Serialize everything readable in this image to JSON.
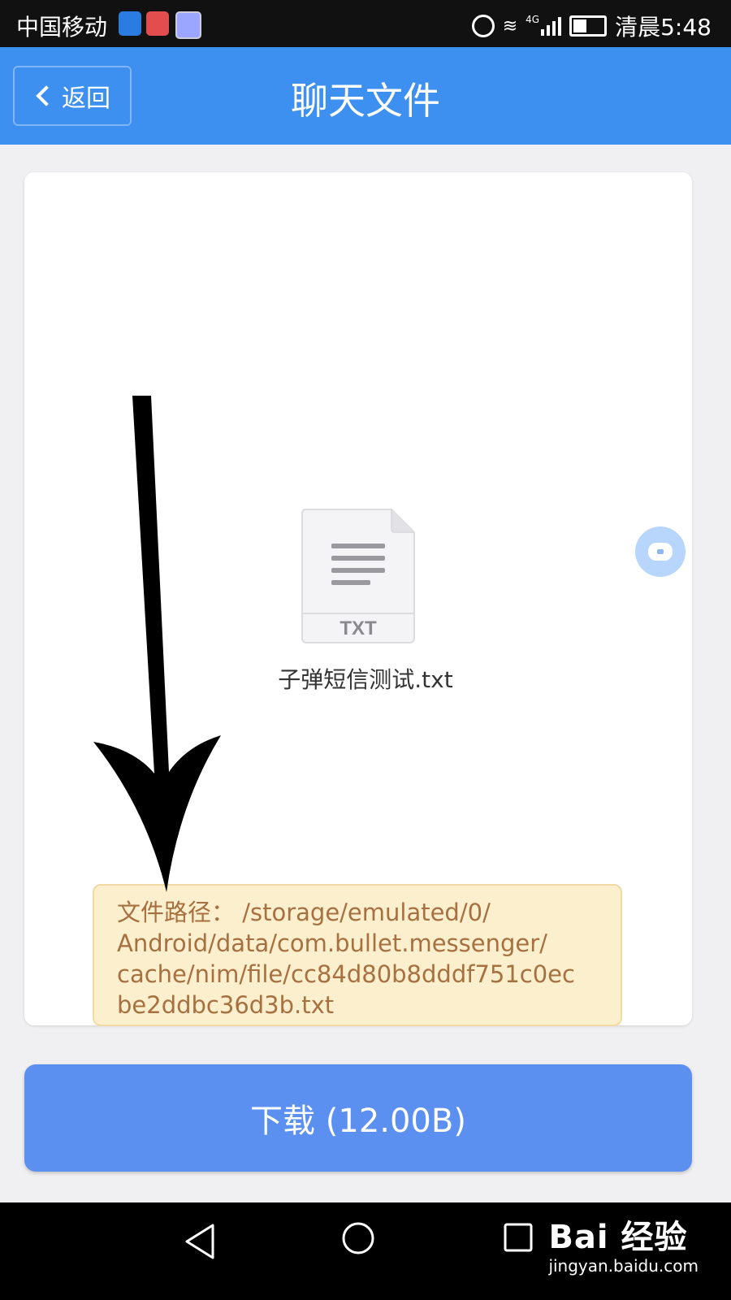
{
  "status_bar": {
    "carrier": "中国移动",
    "network": "4G",
    "time": "清晨5:48"
  },
  "nav": {
    "back_label": "返回",
    "title": "聊天文件"
  },
  "file": {
    "type_label": "TXT",
    "name": "子弹短信测试.txt"
  },
  "path_info": {
    "lines": [
      "文件路径：   /storage/emulated/0/",
      "Android/data/com.bullet.messenger/",
      "cache/nim/file/cc84d80b8dddf751c0ec",
      "be2ddbc36d3b.txt"
    ]
  },
  "download_button": {
    "label": "下载 (12.00B)"
  },
  "watermark": {
    "brand": "Bai 经验",
    "url": "jingyan.baidu.com"
  },
  "colors": {
    "header": "#3d8ff0",
    "button": "#5b8ff0",
    "path_bg": "#fcefcd",
    "path_text": "#a77040"
  }
}
